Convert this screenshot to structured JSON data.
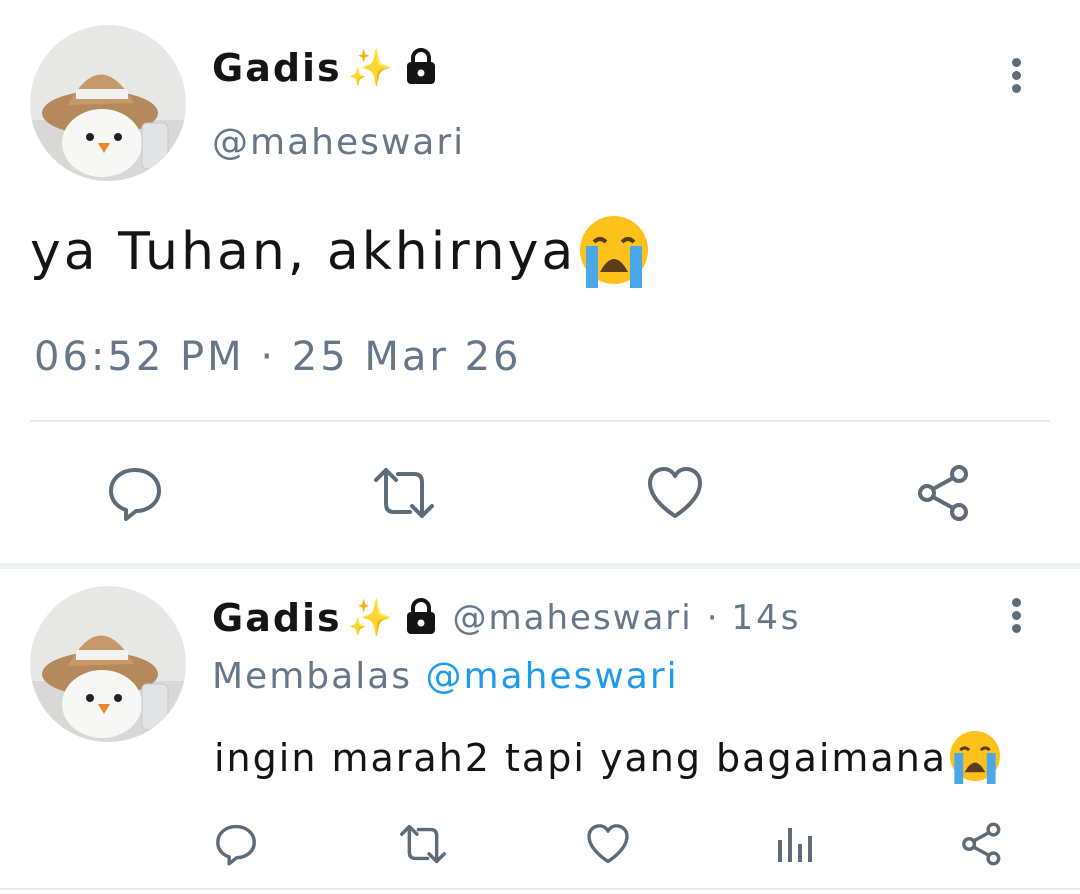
{
  "main_tweet": {
    "display_name": "Gadis",
    "sparkle": "✨",
    "handle": "@maheswari",
    "text": "ya Tuhan, akhirnya",
    "emoji": "😭",
    "timestamp": "06:52 PM · 25 Mar 26",
    "actions": [
      "reply-icon",
      "retweet-icon",
      "like-icon",
      "share-icon"
    ]
  },
  "reply_tweet": {
    "display_name": "Gadis",
    "sparkle": "✨",
    "handle": "@maheswari",
    "separator": "·",
    "age": "14s",
    "replying_prefix": "Membalas",
    "replying_to": "@maheswari",
    "text": "ingin marah2 tapi yang bagaimana",
    "emoji": "😭",
    "actions": [
      "reply-icon",
      "retweet-icon",
      "like-icon",
      "analytics-icon",
      "share-icon"
    ]
  },
  "colors": {
    "text": "#141414",
    "muted": "#66778a",
    "link": "#1d9bf0",
    "divider": "#e6e9ec"
  }
}
